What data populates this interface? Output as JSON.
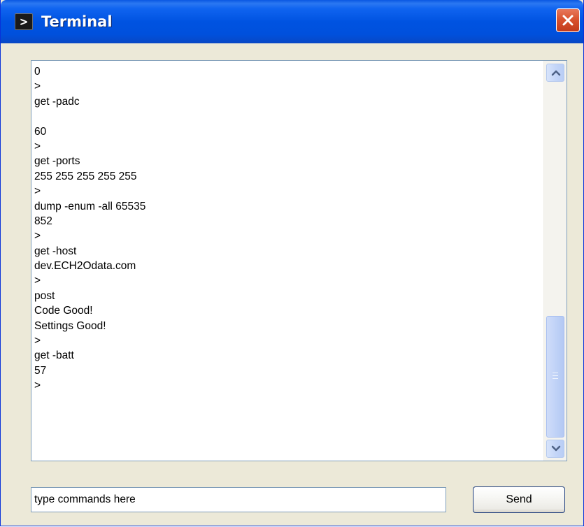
{
  "window": {
    "title": "Terminal",
    "icon_glyph": ">",
    "close_icon": "close-icon"
  },
  "terminal": {
    "lines": [
      "0",
      ">",
      "get -padc",
      "",
      "60",
      ">",
      "get -ports",
      "255 255 255 255 255",
      ">",
      "dump -enum -all 65535",
      "852",
      ">",
      "get -host",
      "dev.ECH2Odata.com",
      ">",
      "post",
      "Code Good!",
      "Settings Good!",
      ">",
      "get -batt",
      "57",
      ">"
    ]
  },
  "scrollbar": {
    "thumb_position": 0.87,
    "up_icon": "chevron-up-icon",
    "down_icon": "chevron-down-icon"
  },
  "command": {
    "value": "type commands here",
    "send_label": "Send"
  },
  "colors": {
    "titlebar": "#0053e1",
    "window_bg": "#ece9d8",
    "close_button": "#d9532f",
    "field_border": "#7f9db9"
  }
}
